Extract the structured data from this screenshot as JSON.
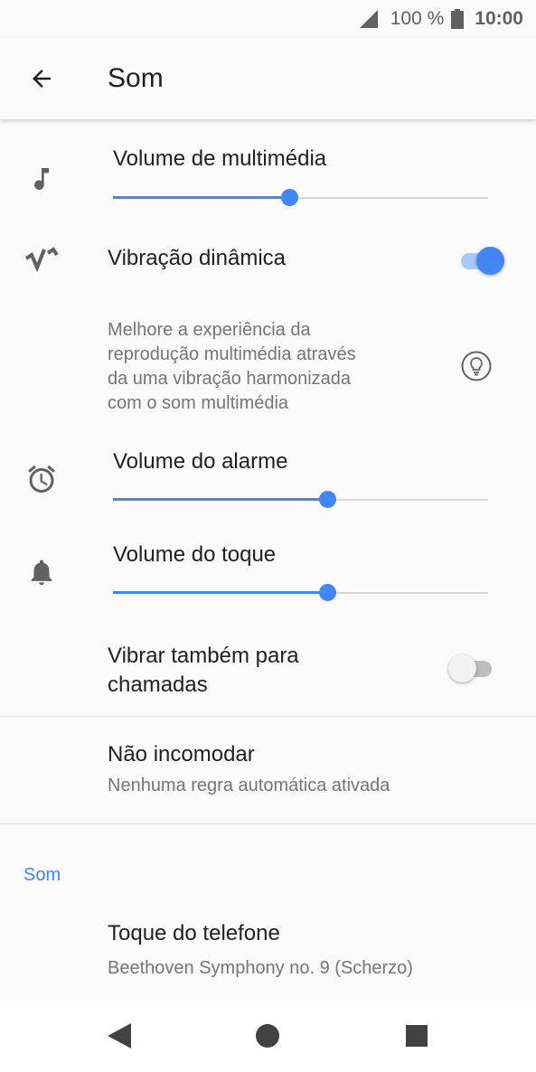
{
  "status_bar": {
    "battery_percent": "100 %",
    "time": "10:00",
    "icons": [
      "signal-icon",
      "battery-icon"
    ]
  },
  "app_bar": {
    "title": "Som",
    "back_icon": "arrow-back-icon"
  },
  "settings": {
    "media_volume": {
      "label": "Volume de multimédia",
      "icon": "music-note-icon",
      "level": 0.47
    },
    "dynamic_vibration": {
      "label": "Vibração dinâmica",
      "icon": "dynamic-vibration-icon",
      "enabled": true,
      "description_lines": [
        "Melhore a experiência da",
        "reprodução multimédia através",
        "da uma vibração harmonizada",
        "com o som multimédia"
      ],
      "hint_icon": "lightbulb-icon"
    },
    "alarm_volume": {
      "label": "Volume do alarme",
      "icon": "alarm-clock-icon",
      "level": 0.57
    },
    "ring_volume": {
      "label": "Volume do toque",
      "icon": "bell-icon",
      "level": 0.57
    },
    "vibrate_calls": {
      "label_lines": [
        "Vibrar também para",
        "chamadas"
      ],
      "enabled": false
    },
    "do_not_disturb": {
      "label": "Não incomodar",
      "summary": "Nenhuma regra automática ativada"
    },
    "section_sound": "Som",
    "ringtone": {
      "label": "Toque do telefone",
      "summary": "Beethoven Symphony no. 9 (Scherzo)"
    }
  },
  "nav_bar": {
    "buttons": [
      "back-triangle-icon",
      "home-circle-icon",
      "recents-square-icon"
    ]
  },
  "colors": {
    "accent": "#4285f4",
    "accent_light": "#a8c7fa",
    "text_primary": "#212121",
    "text_secondary": "#757575",
    "background": "#fafafa"
  }
}
